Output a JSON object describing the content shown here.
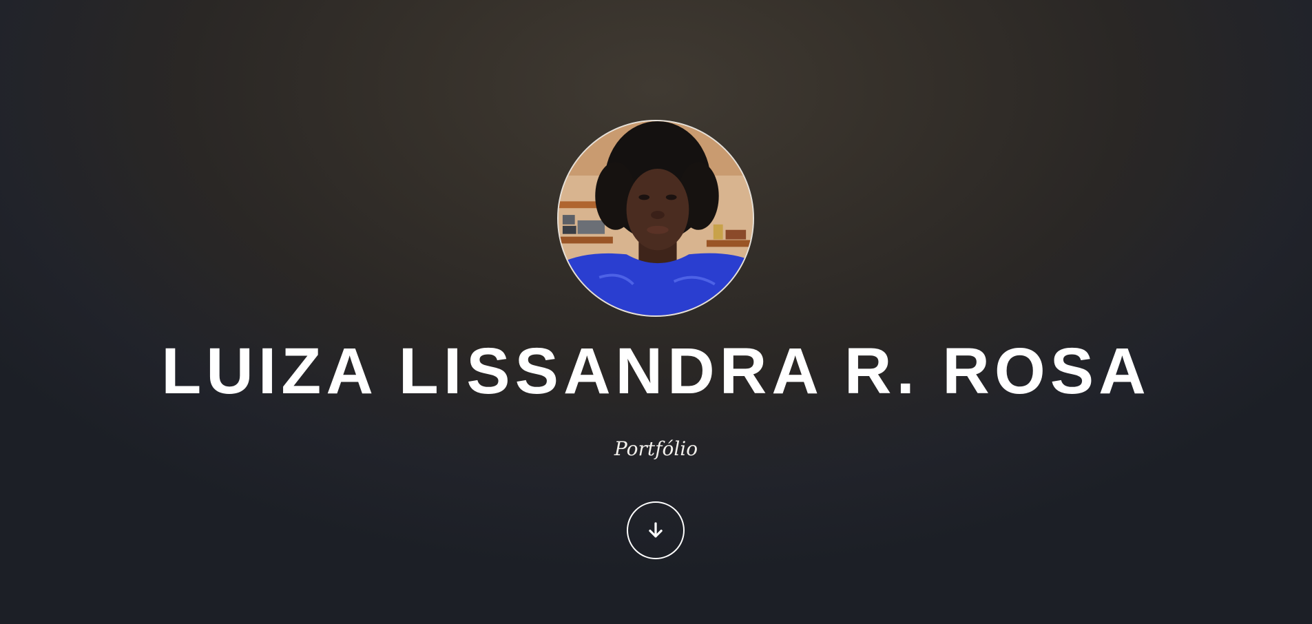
{
  "hero": {
    "name": "LUIZA LISSANDRA R. ROSA",
    "subtitle": "Portfólio",
    "avatar_icon": "profile-photo",
    "scroll_icon": "arrow-down-icon"
  },
  "colors": {
    "background": "#2a2725",
    "text": "#ffffff"
  }
}
